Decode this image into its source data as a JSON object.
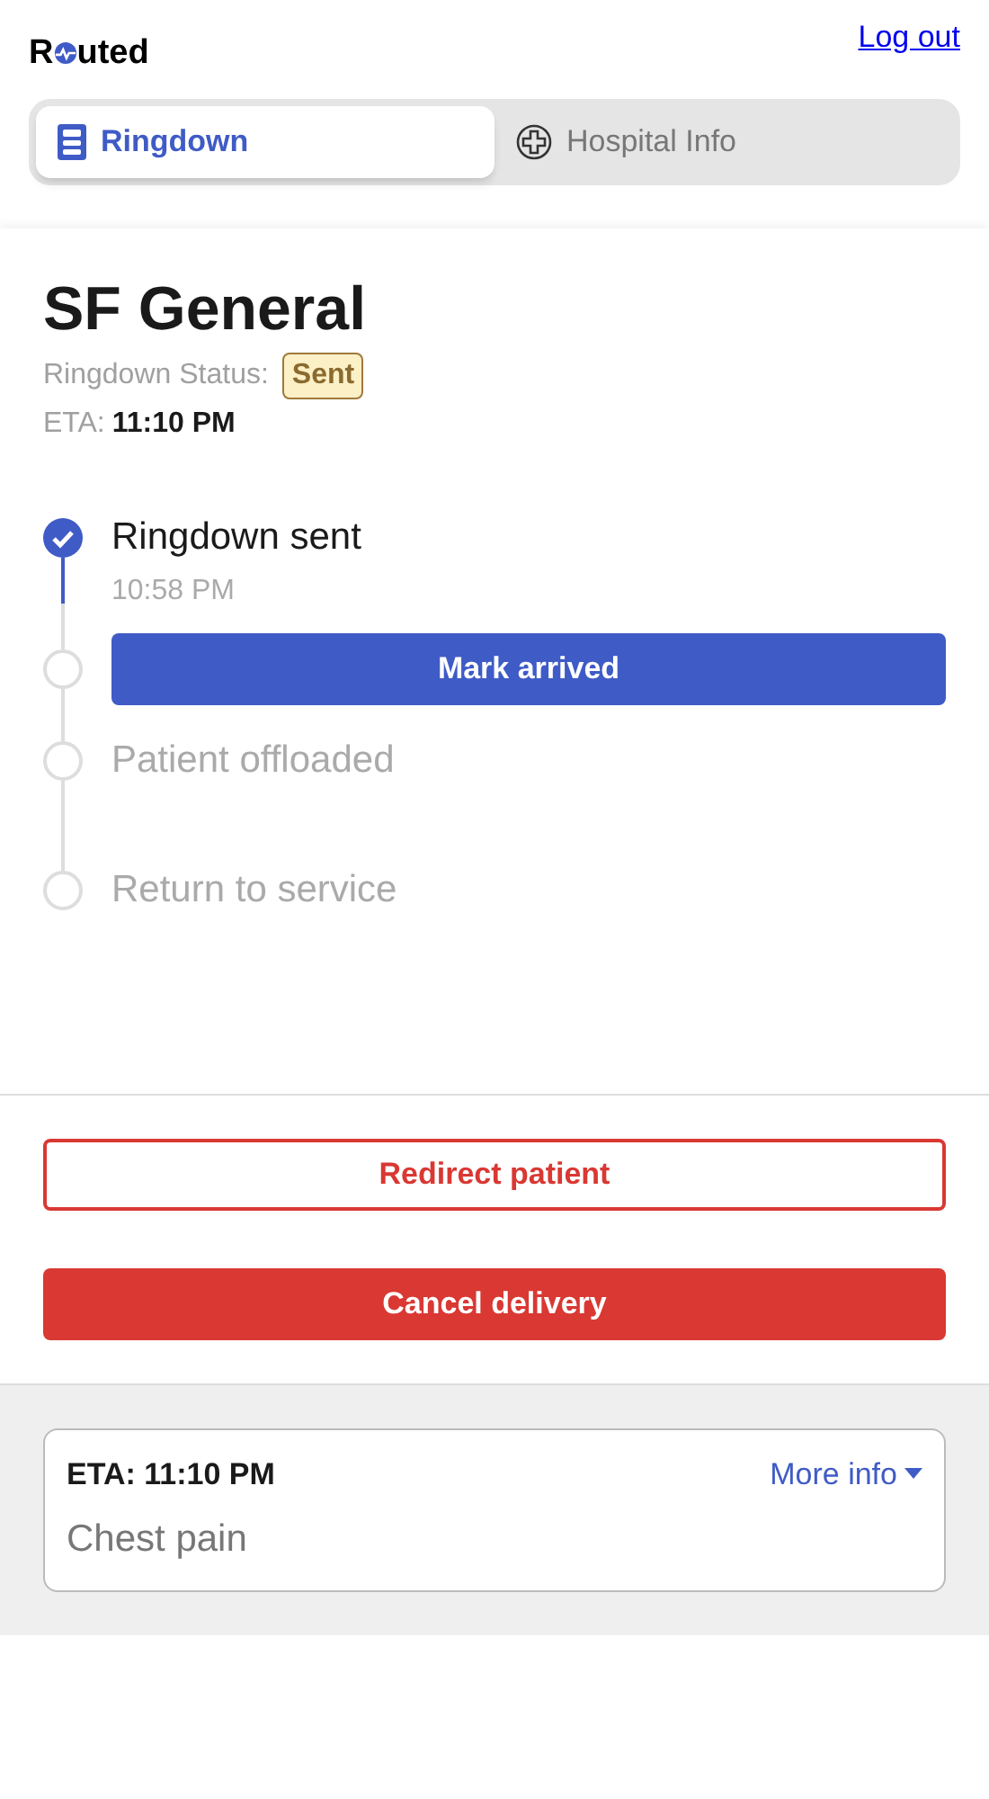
{
  "header": {
    "logo_start": "R",
    "logo_end": "uted",
    "logout": "Log out"
  },
  "tabs": [
    {
      "label": "Ringdown",
      "selected": true,
      "kind": "ringdown"
    },
    {
      "label": "Hospital Info",
      "selected": false,
      "kind": "hospital"
    }
  ],
  "hospital": {
    "name": "SF General",
    "status_label": "Ringdown Status:",
    "status": "Sent",
    "eta_label": "ETA:",
    "eta": "11:10 PM"
  },
  "steps": [
    {
      "kind": "text",
      "label": "Ringdown sent",
      "time": "10:58 PM",
      "done": true
    },
    {
      "kind": "action",
      "label": "Mark arrived",
      "done": false
    },
    {
      "kind": "text",
      "label": "Patient offloaded",
      "done": false
    },
    {
      "kind": "text",
      "label": "Return to service",
      "done": false
    }
  ],
  "actions": [
    {
      "label": "Redirect patient",
      "kind": "outline"
    },
    {
      "label": "Cancel delivery",
      "kind": "solid"
    }
  ],
  "summary": {
    "eta": "ETA: 11:10 PM",
    "more": "More info",
    "complaint": "Chest pain"
  }
}
